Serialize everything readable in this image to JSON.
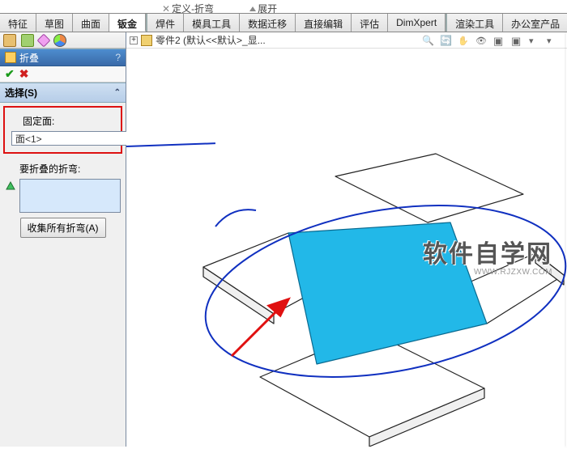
{
  "top_hint": {
    "x_label": "✕",
    "text": "定义-折弯",
    "after_icon": "展开"
  },
  "ribbon": {
    "tabs": [
      "特征",
      "草图",
      "曲面",
      "钣金",
      "焊件",
      "模具工具",
      "数据迁移",
      "直接编辑",
      "评估",
      "DimXpert",
      "渲染工具",
      "办公室产品"
    ],
    "active_index": 3
  },
  "panel": {
    "feature_title": "折叠",
    "help": "?",
    "section_select": "选择(S)",
    "fixed_face_label": "固定面:",
    "fixed_face_value": "面<1>",
    "bends_label": "要折叠的折弯:",
    "collect_button": "收集所有折弯(A)"
  },
  "viewport": {
    "tree_root": "零件2 (默认<<默认>_显..."
  },
  "watermark": {
    "cn": "软件自学网",
    "en": "WWW.RJZXW.COM"
  }
}
